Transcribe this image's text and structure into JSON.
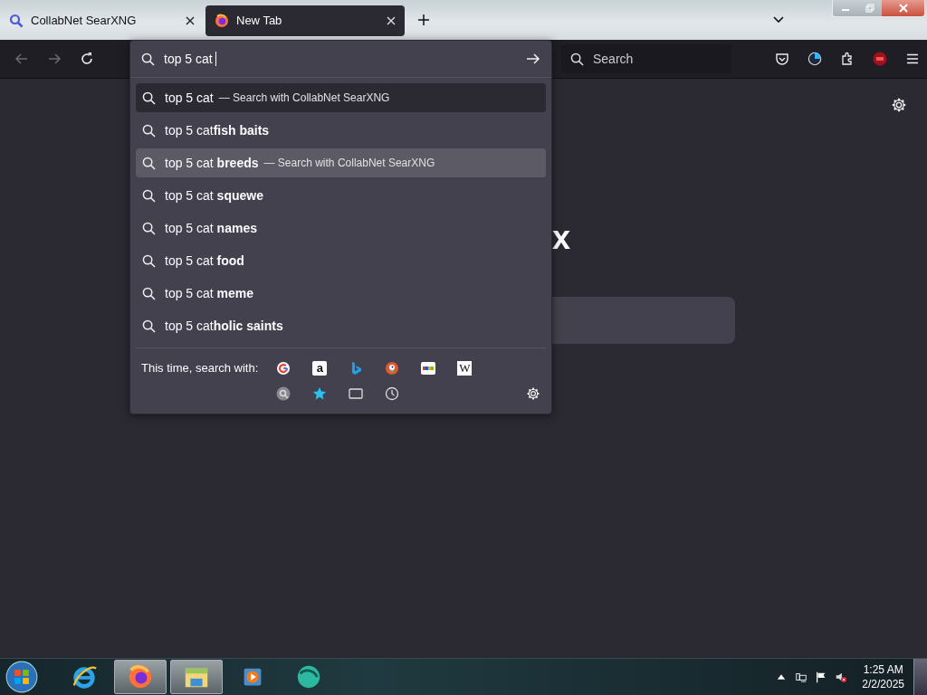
{
  "tabs": [
    {
      "title": "CollabNet SearXNG",
      "kind": "search",
      "selected": false
    },
    {
      "title": "New Tab",
      "kind": "firefox",
      "selected": true
    }
  ],
  "toolbar": {
    "search": {
      "placeholder": "Search"
    }
  },
  "address_bar": {
    "value": "top 5 cat"
  },
  "suggestions": [
    {
      "kind": "heuristic",
      "text": "top 5 cat",
      "action": "— Search with CollabNet SearXNG",
      "selected": false
    },
    {
      "kind": "suggestion",
      "text": "top 5 cat**fish baits**",
      "selected": false
    },
    {
      "kind": "suggestion",
      "text": "top 5 cat **breeds**",
      "action": "— Search with CollabNet SearXNG",
      "selected": true
    },
    {
      "kind": "suggestion",
      "text": "top 5 cat **squewe**",
      "selected": false
    },
    {
      "kind": "suggestion",
      "text": "top 5 cat **names**",
      "selected": false
    },
    {
      "kind": "suggestion",
      "text": "top 5 cat **food**",
      "selected": false
    },
    {
      "kind": "suggestion",
      "text": "top 5 cat **meme**",
      "selected": false
    },
    {
      "kind": "suggestion",
      "text": "top 5 cat**holic saints**",
      "selected": false
    }
  ],
  "search_with": {
    "label": "This time, search with:",
    "engines": [
      {
        "kind": "google"
      },
      {
        "kind": "amazon",
        "label": "a"
      },
      {
        "kind": "bing"
      },
      {
        "kind": "duckduckgo"
      },
      {
        "kind": "ebay"
      },
      {
        "kind": "wikipedia",
        "label": "W"
      }
    ],
    "modes": [
      {
        "kind": "searxng"
      },
      {
        "kind": "bookmarks"
      },
      {
        "kind": "tabs"
      },
      {
        "kind": "history"
      }
    ]
  },
  "page": {
    "heading": "x"
  },
  "clock": {
    "time": "1:25 AM",
    "date": "2/2/2025"
  },
  "taskbar": {
    "apps": [
      {
        "kind": "ie",
        "active": false
      },
      {
        "kind": "firefox",
        "active": true
      },
      {
        "kind": "explorer",
        "active": true
      },
      {
        "kind": "media",
        "active": false
      },
      {
        "kind": "globe",
        "active": false
      }
    ]
  }
}
